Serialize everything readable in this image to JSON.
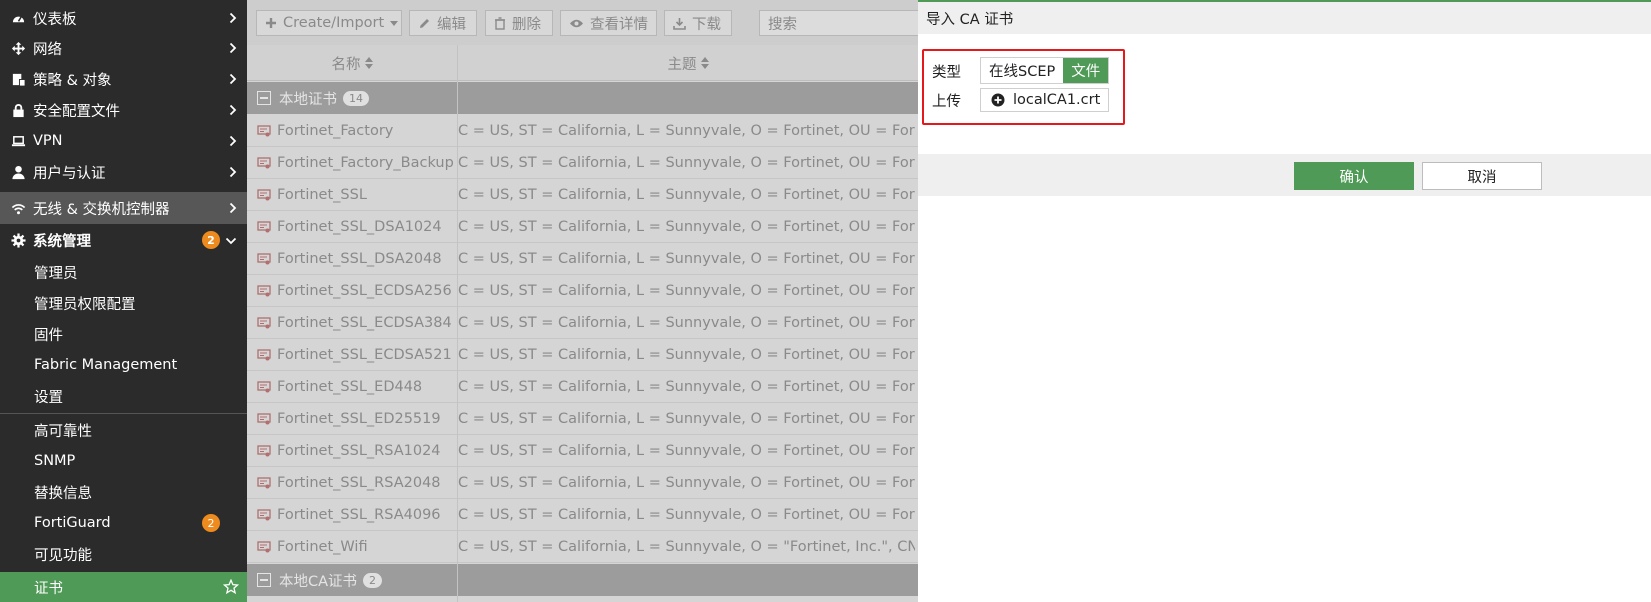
{
  "sidebar": {
    "items": [
      {
        "label": "仪表板",
        "icon": "dashboard-icon"
      },
      {
        "label": "网络",
        "icon": "network-icon"
      },
      {
        "label": "策略 & 对象",
        "icon": "policy-icon"
      },
      {
        "label": "安全配置文件",
        "icon": "lock-icon"
      },
      {
        "label": "VPN",
        "icon": "laptop-icon"
      },
      {
        "label": "用户与认证",
        "icon": "user-icon"
      },
      {
        "label": "无线 & 交换机控制器",
        "icon": "wifi-icon"
      },
      {
        "label": "系统管理",
        "icon": "gear-icon",
        "badge": "2"
      }
    ],
    "subitems": [
      {
        "label": "管理员"
      },
      {
        "label": "管理员权限配置"
      },
      {
        "label": "固件"
      },
      {
        "label": "Fabric Management"
      },
      {
        "label": "设置"
      },
      {
        "label": "高可靠性"
      },
      {
        "label": "SNMP"
      },
      {
        "label": "替换信息"
      },
      {
        "label": "FortiGuard",
        "badge": "2"
      },
      {
        "label": "可见功能"
      },
      {
        "label": "证书"
      }
    ]
  },
  "toolbar": {
    "create_label": "Create/Import",
    "edit_label": "编辑",
    "delete_label": "删除",
    "view_label": "查看详情",
    "download_label": "下载",
    "search_placeholder": "搜索"
  },
  "table": {
    "columns": [
      "名称",
      "主题"
    ],
    "group_local": {
      "label": "本地证书",
      "count": "14"
    },
    "group_ca": {
      "label": "本地CA证书",
      "count": "2"
    },
    "rows": [
      {
        "name": "Fortinet_Factory",
        "subject": "C = US, ST = California, L = Sunnyvale, O = Fortinet, OU = FortiGate, ..."
      },
      {
        "name": "Fortinet_Factory_Backup",
        "subject": "C = US, ST = California, L = Sunnyvale, O = Fortinet, OU = FortiGate, ..."
      },
      {
        "name": "Fortinet_SSL",
        "subject": "C = US, ST = California, L = Sunnyvale, O = Fortinet, OU = FortiGate, ..."
      },
      {
        "name": "Fortinet_SSL_DSA1024",
        "subject": "C = US, ST = California, L = Sunnyvale, O = Fortinet, OU = FortiGate, ..."
      },
      {
        "name": "Fortinet_SSL_DSA2048",
        "subject": "C = US, ST = California, L = Sunnyvale, O = Fortinet, OU = FortiGate, ..."
      },
      {
        "name": "Fortinet_SSL_ECDSA256",
        "subject": "C = US, ST = California, L = Sunnyvale, O = Fortinet, OU = FortiGate, ..."
      },
      {
        "name": "Fortinet_SSL_ECDSA384",
        "subject": "C = US, ST = California, L = Sunnyvale, O = Fortinet, OU = FortiGate, ..."
      },
      {
        "name": "Fortinet_SSL_ECDSA521",
        "subject": "C = US, ST = California, L = Sunnyvale, O = Fortinet, OU = FortiGate, ..."
      },
      {
        "name": "Fortinet_SSL_ED448",
        "subject": "C = US, ST = California, L = Sunnyvale, O = Fortinet, OU = FortiGate, ..."
      },
      {
        "name": "Fortinet_SSL_ED25519",
        "subject": "C = US, ST = California, L = Sunnyvale, O = Fortinet, OU = FortiGate, ..."
      },
      {
        "name": "Fortinet_SSL_RSA1024",
        "subject": "C = US, ST = California, L = Sunnyvale, O = Fortinet, OU = FortiGate, ..."
      },
      {
        "name": "Fortinet_SSL_RSA2048",
        "subject": "C = US, ST = California, L = Sunnyvale, O = Fortinet, OU = FortiGate, ..."
      },
      {
        "name": "Fortinet_SSL_RSA4096",
        "subject": "C = US, ST = California, L = Sunnyvale, O = Fortinet, OU = FortiGate, ..."
      },
      {
        "name": "Fortinet_Wifi",
        "subject": "C = US, ST = California, L = Sunnyvale, O = \"Fortinet, Inc.\", CN = auth-..."
      }
    ]
  },
  "dialog": {
    "title": "导入 CA 证书",
    "type_label": "类型",
    "type_options": [
      "在线SCEP",
      "文件"
    ],
    "type_selected": "文件",
    "upload_label": "上传",
    "upload_file": "localCA1.crt",
    "ok_label": "确认",
    "cancel_label": "取消"
  },
  "colors": {
    "accent": "#4e9a56",
    "highlight": "#e3191b",
    "badge": "#ee8b1e",
    "sidebar_bg": "#2b2b2b"
  }
}
